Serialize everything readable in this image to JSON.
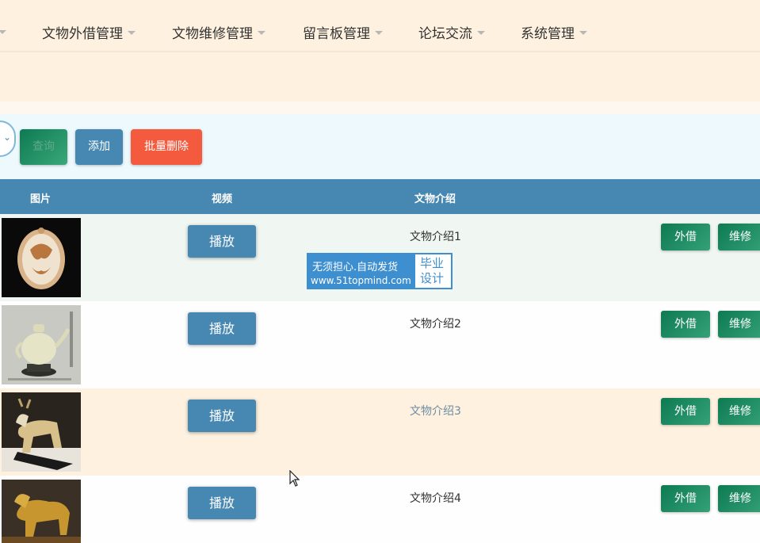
{
  "nav": {
    "items": [
      {
        "label": "文物外借管理"
      },
      {
        "label": "文物维修管理"
      },
      {
        "label": "留言板管理"
      },
      {
        "label": "论坛交流"
      },
      {
        "label": "系统管理"
      }
    ]
  },
  "toolbar": {
    "select_icon": "chevron-down-icon",
    "query_label": "查询",
    "add_label": "添加",
    "batch_delete_label": "批量删除"
  },
  "table": {
    "headers": {
      "image": "图片",
      "video": "视频",
      "intro": "文物介绍"
    },
    "rows": [
      {
        "intro": "文物介绍1",
        "play": "播放",
        "lend": "外借",
        "repair": "维修",
        "bg": "#f0f6f1"
      },
      {
        "intro": "文物介绍2",
        "play": "播放",
        "lend": "外借",
        "repair": "维修",
        "bg": "#fefefe"
      },
      {
        "intro": "文物介绍3",
        "play": "播放",
        "lend": "外借",
        "repair": "维修",
        "bg": "#fef1df"
      },
      {
        "intro": "文物介绍4",
        "play": "播放",
        "lend": "外借",
        "repair": "维修",
        "bg": "#fefefe"
      }
    ]
  },
  "watermark": {
    "line1": "无须担心.自动发货",
    "line2": "www.51topmind.com",
    "badge": "毕业设计"
  },
  "colors": {
    "primary": "#4788b2",
    "success": "#0e7a52",
    "danger": "#f45a3d",
    "nav_bg": "#fef1df",
    "toolbar_bg": "#eef9fd"
  }
}
